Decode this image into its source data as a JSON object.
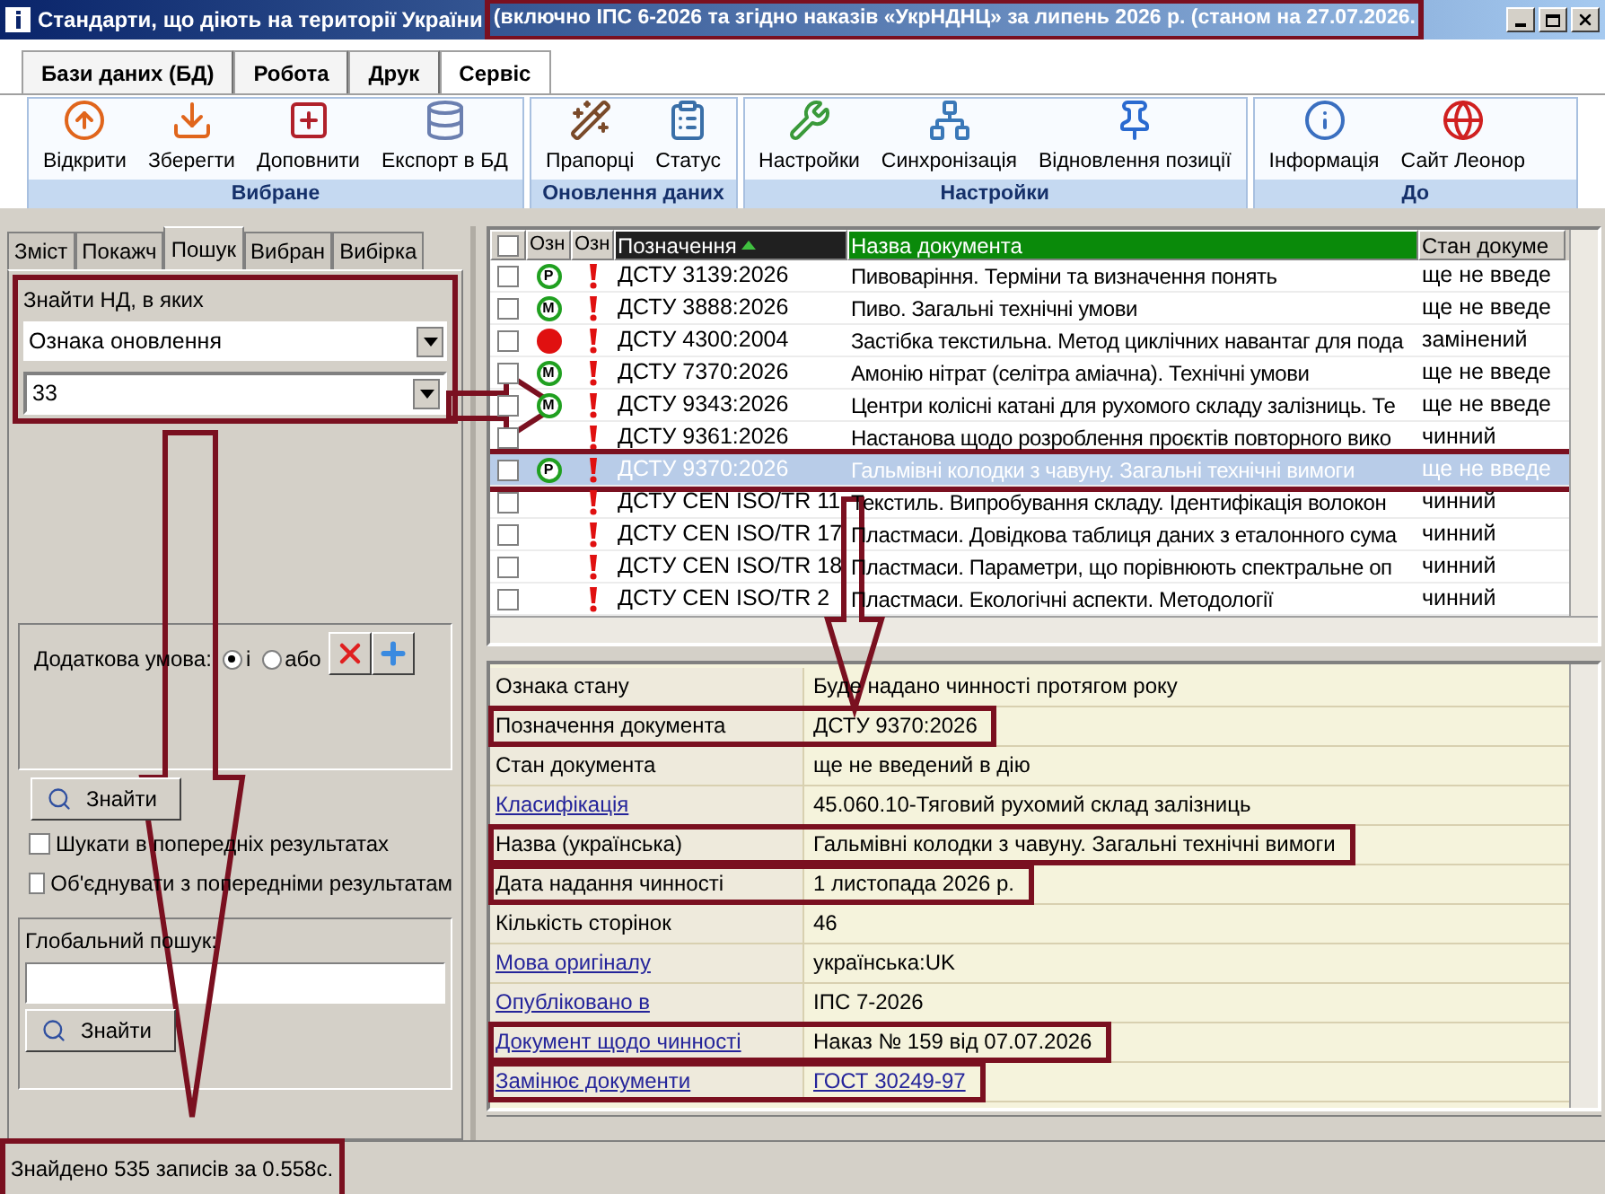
{
  "window": {
    "title": "Стандарти, що діють на території України",
    "title_note": "(включно ІПС 6-2026  та згідно наказів «УкрНДНЦ» за  липень 2026 р. (станом  на 27.07.2026.",
    "title_note_highlighted": true
  },
  "menu_tabs": [
    {
      "label": "Бази даних (БД)",
      "selected": false
    },
    {
      "label": "Робота",
      "selected": false
    },
    {
      "label": "Друк",
      "selected": false
    },
    {
      "label": "Сервіс",
      "selected": true
    }
  ],
  "ribbon_groups": [
    {
      "title": "Вибране",
      "buttons": [
        {
          "label": "Відкрити",
          "kind": "open"
        },
        {
          "label": "Зберегти",
          "kind": "save"
        },
        {
          "label": "Доповнити",
          "kind": "add"
        },
        {
          "label": "Експорт в БД",
          "kind": "export"
        }
      ]
    },
    {
      "title": "Оновлення даних",
      "buttons": [
        {
          "label": "Прапорці",
          "kind": "wand"
        },
        {
          "label": "Статус",
          "kind": "status"
        }
      ]
    },
    {
      "title": "Настройки",
      "buttons": [
        {
          "label": "Настройки",
          "kind": "wrench"
        },
        {
          "label": "Синхронізація",
          "kind": "sync"
        },
        {
          "label": "Відновлення позиції",
          "kind": "pin"
        }
      ]
    },
    {
      "title": "До",
      "buttons": [
        {
          "label": "Інформація",
          "kind": "info"
        },
        {
          "label": "Сайт Леонор",
          "kind": "globe"
        }
      ]
    }
  ],
  "left_tabs": [
    {
      "label": "Зміст",
      "selected": false
    },
    {
      "label": "Покажч",
      "selected": false
    },
    {
      "label": "Пошук",
      "selected": true
    },
    {
      "label": "Вибран",
      "selected": false
    },
    {
      "label": "Вибірка",
      "selected": false
    }
  ],
  "search": {
    "title": "Знайти НД, в яких",
    "field": "Ознака оновлення",
    "value": "33",
    "highlighted": true
  },
  "extra_condition": {
    "label": "Додаткова умова:",
    "options": [
      {
        "label": "і",
        "selected": true
      },
      {
        "label": "або",
        "selected": false
      }
    ]
  },
  "find_button": "Знайти",
  "checkboxes": [
    {
      "label": "Шукати в попередніх результатах",
      "checked": false
    },
    {
      "label": "Об'єднувати з попередніми результатам",
      "checked": false
    }
  ],
  "global_search": {
    "title": "Глобальний пошук:",
    "button": "Знайти"
  },
  "table": {
    "select_all": {
      "checked": false
    },
    "columns": [
      {
        "label": "Озн"
      },
      {
        "label": "Озн"
      },
      {
        "label": "Позначення",
        "sorted": true,
        "color": "#202020"
      },
      {
        "label": "Назва документа",
        "color": "#0a8a0a"
      },
      {
        "label": "Стан докуме"
      }
    ],
    "rows": [
      {
        "checked": false,
        "kind": "letter",
        "badge": "P",
        "flag": true,
        "code": "ДСТУ 3139:2026",
        "name": "Пивоваріння. Терміни та визначення понять",
        "state": "ще не введе",
        "selected": false
      },
      {
        "checked": false,
        "kind": "letter",
        "badge": "M",
        "flag": true,
        "code": "ДСТУ 3888:2026",
        "name": "Пиво. Загальні технічні умови",
        "state": "ще не введе",
        "selected": false
      },
      {
        "checked": false,
        "kind": "dot",
        "flag": true,
        "code": "ДСТУ 4300:2004",
        "name": "Застібка текстильна. Метод циклічних навантаг для пода",
        "state": "замінений",
        "selected": false
      },
      {
        "checked": false,
        "kind": "letter",
        "badge": "M",
        "flag": true,
        "code": "ДСТУ 7370:2026",
        "name": "Амонію нітрат (селітра аміачна). Технічні умови",
        "state": "ще не введе",
        "selected": false
      },
      {
        "checked": false,
        "kind": "letter",
        "badge": "M",
        "flag": true,
        "code": "ДСТУ 9343:2026",
        "name": "Центри колісні катані для рухомого складу залізниць. Те",
        "state": "ще не введе",
        "selected": false
      },
      {
        "checked": false,
        "kind": "none",
        "flag": true,
        "code": "ДСТУ 9361:2026",
        "name": "Настанова щодо розроблення проєктів повторного вико",
        "state": "чинний",
        "selected": false
      },
      {
        "checked": false,
        "kind": "letter",
        "badge": "P",
        "flag": true,
        "code": "ДСТУ 9370:2026",
        "name": "Гальмівні колодки з чавуну. Загальні технічні вимоги",
        "state": "ще не введе",
        "selected": true
      },
      {
        "checked": false,
        "kind": "none",
        "flag": true,
        "code": "ДСТУ CEN ISO/TR 11",
        "name": "Текстиль. Випробування складу. Ідентифікація волокон",
        "state": "чинний",
        "selected": false
      },
      {
        "checked": false,
        "kind": "none",
        "flag": true,
        "code": "ДСТУ CEN ISO/TR 17",
        "name": "Пластмаси. Довідкова таблиця даних з еталонного сума",
        "state": "чинний",
        "selected": false
      },
      {
        "checked": false,
        "kind": "none",
        "flag": true,
        "code": "ДСТУ CEN ISO/TR 18",
        "name": "Пластмаси. Параметри, що порівнюють спектральне оп",
        "state": "чинний",
        "selected": false
      },
      {
        "checked": false,
        "kind": "none",
        "flag": true,
        "code": "ДСТУ CEN ISO/TR 2",
        "name": "Пластмаси. Екологічні аспекти. Методології",
        "state": "чинний",
        "selected": false
      }
    ]
  },
  "details": [
    {
      "label": "Ознака стану",
      "value": "Буде надано чинності протягом року",
      "label_link": false,
      "value_link": false,
      "highlighted": false
    },
    {
      "label": "Позначення документа",
      "value": "ДСТУ 9370:2026",
      "label_link": false,
      "value_link": false,
      "highlighted": true
    },
    {
      "label": "Стан документа",
      "value": "ще не введений в дію",
      "label_link": false,
      "value_link": false,
      "highlighted": false
    },
    {
      "label": "Класифікація",
      "value": "45.060.10-Тяговий рухомий склад залізниць",
      "label_link": true,
      "value_link": false,
      "highlighted": false
    },
    {
      "label": "Назва (українська)",
      "value": "Гальмівні колодки з чавуну. Загальні технічні вимоги",
      "label_link": false,
      "value_link": false,
      "highlighted": true
    },
    {
      "label": "Дата надання чинності",
      "value": "1 листопада 2026 р.",
      "label_link": false,
      "value_link": false,
      "highlighted": true
    },
    {
      "label": "Кількість сторінок",
      "value": "46",
      "label_link": false,
      "value_link": false,
      "highlighted": false
    },
    {
      "label": "Мова оригіналу",
      "value": "українська:UK",
      "label_link": true,
      "value_link": false,
      "highlighted": false
    },
    {
      "label": "Опубліковано в",
      "value": "ІПС 7-2026",
      "label_link": true,
      "value_link": false,
      "highlighted": false
    },
    {
      "label": "Документ щодо чинності",
      "value": "Наказ № 159 від 07.07.2026",
      "label_link": true,
      "value_link": false,
      "highlighted": true
    },
    {
      "label": "Замінює документи",
      "value": "ГОСТ 30249-97",
      "label_link": true,
      "value_link": true,
      "highlighted": true
    }
  ],
  "status_bar": {
    "text": "Знайдено 535 записів за 0.558с.",
    "highlighted": true
  }
}
